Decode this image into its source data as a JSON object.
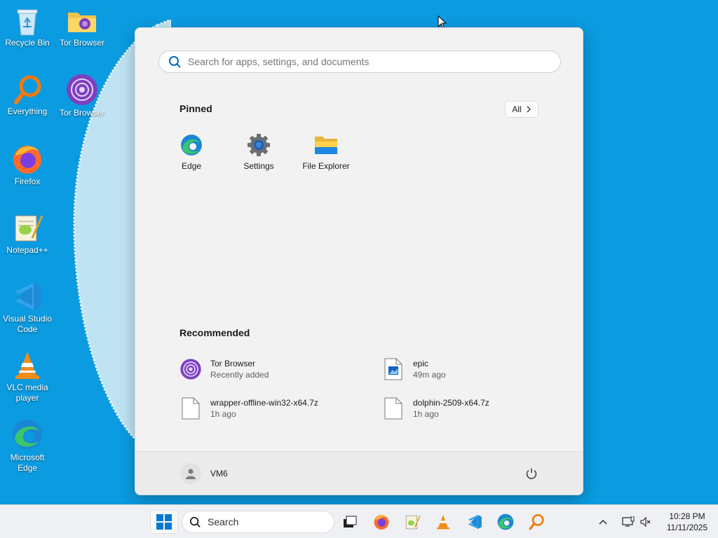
{
  "desktop": {
    "icons": [
      {
        "label": "Recycle Bin",
        "icon": "recycle-bin-icon"
      },
      {
        "label": "Tor Browser",
        "icon": "folder-icon"
      },
      {
        "label": "Everything",
        "icon": "everything-icon"
      },
      {
        "label": "Tor Browser",
        "icon": "tor-browser-icon"
      },
      {
        "label": "Firefox",
        "icon": "firefox-icon"
      },
      {
        "label": "Notepad++",
        "icon": "notepad-plus-plus-icon"
      },
      {
        "label": "Visual Studio Code",
        "icon": "vscode-icon"
      },
      {
        "label": "VLC media player",
        "icon": "vlc-icon"
      },
      {
        "label": "Microsoft Edge",
        "icon": "edge-icon"
      }
    ]
  },
  "start_menu": {
    "search_placeholder": "Search for apps, settings, and documents",
    "pinned_title": "Pinned",
    "all_label": "All",
    "pinned": [
      {
        "label": "Edge",
        "icon": "edge-icon"
      },
      {
        "label": "Settings",
        "icon": "gear-icon"
      },
      {
        "label": "File Explorer",
        "icon": "folder-icon"
      }
    ],
    "recommended_title": "Recommended",
    "recommended": [
      {
        "name": "Tor Browser",
        "sub": "Recently added",
        "icon": "tor-browser-icon"
      },
      {
        "name": "epic",
        "sub": "49m ago",
        "icon": "image-file-icon"
      },
      {
        "name": "wrapper-offline-win32-x64.7z",
        "sub": "1h ago",
        "icon": "file-icon"
      },
      {
        "name": "dolphin-2509-x64.7z",
        "sub": "1h ago",
        "icon": "file-icon"
      }
    ],
    "user_name": "VM6"
  },
  "taskbar": {
    "search_label": "Search",
    "apps": [
      "task-view-icon",
      "firefox-icon",
      "notepad-plus-plus-icon",
      "vlc-icon",
      "vscode-icon",
      "edge-icon",
      "everything-icon"
    ],
    "time": "10:28 PM",
    "date": "11/11/2025"
  },
  "colors": {
    "desktop_bg": "#0b9be0",
    "menu_bg": "#f2f2f2",
    "accent": "#0067c0"
  }
}
